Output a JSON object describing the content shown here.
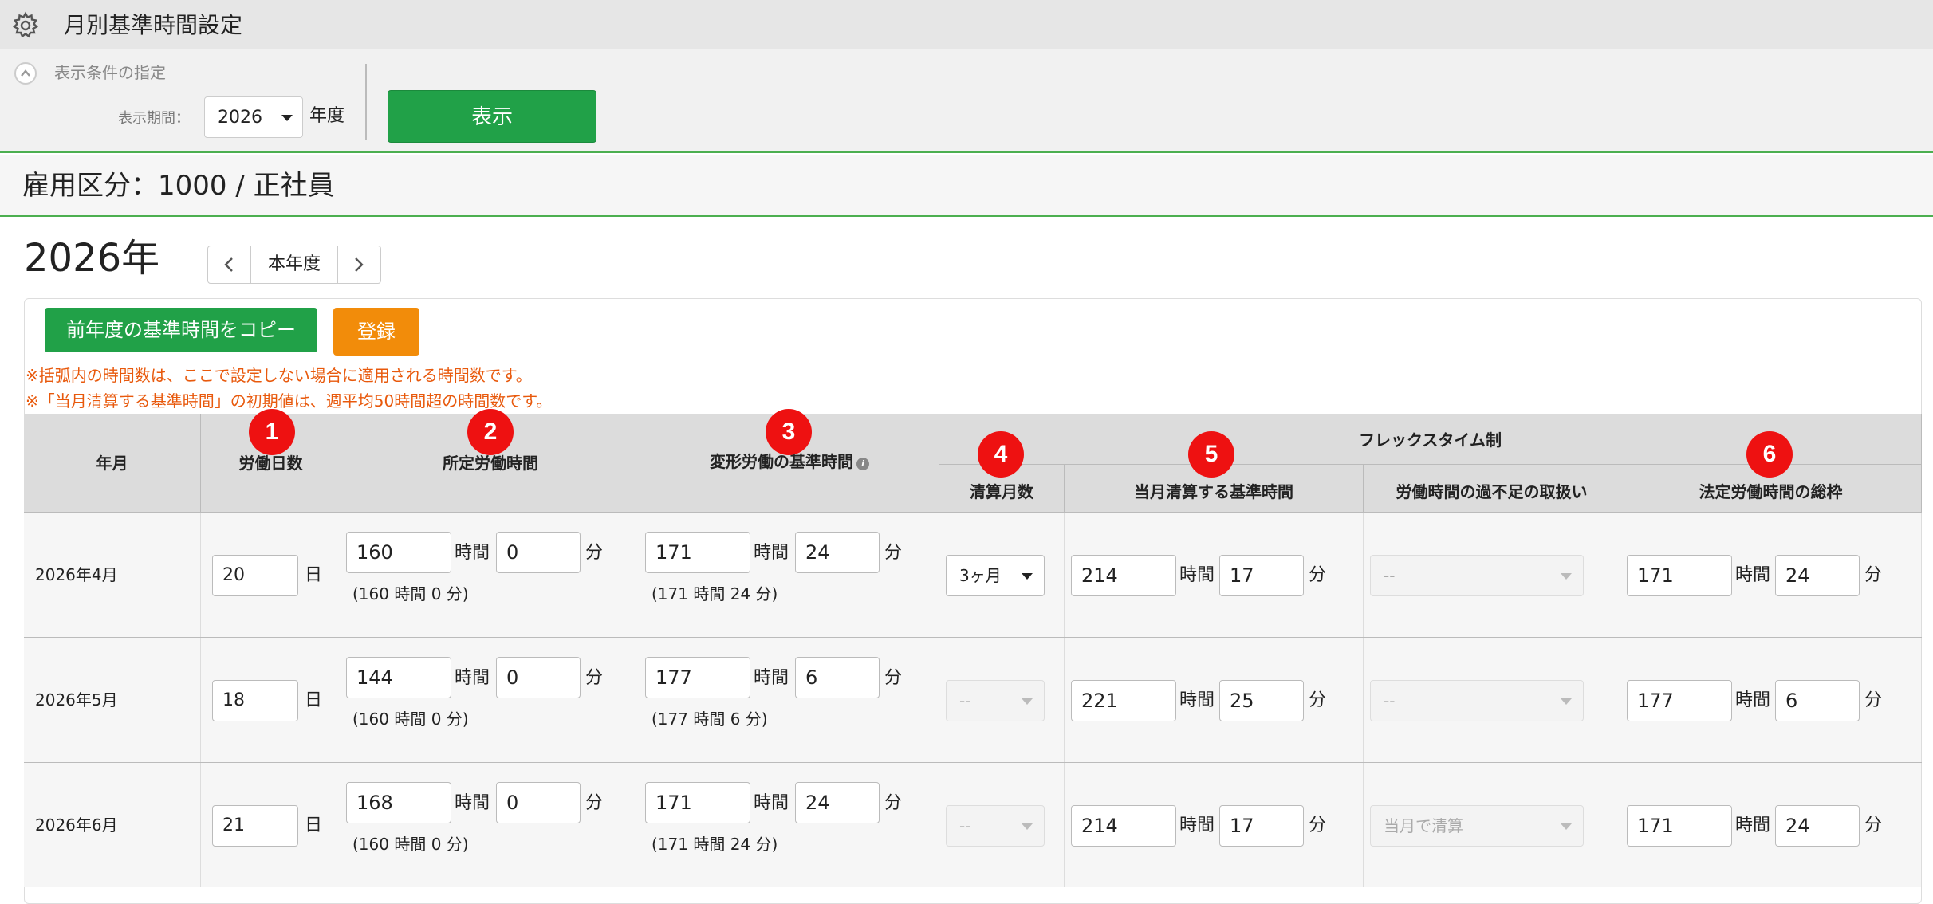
{
  "app": {
    "title": "月別基準時間設定",
    "icon": "gear-icon"
  },
  "conditions": {
    "toggle_label": "表示条件の指定",
    "period_label": "表示期間：",
    "year_value": "2026",
    "year_suffix": "年度",
    "show_button": "表示"
  },
  "employment": {
    "label": "雇用区分：1000 / 正社員"
  },
  "year_nav": {
    "title": "2026年",
    "current_label": "本年度"
  },
  "actions": {
    "copy_button": "前年度の基準時間をコピー",
    "register_button": "登録"
  },
  "notes": [
    "※括弧内の時間数は、ここで設定しない場合に適用される時間数です。",
    "※「当月清算する基準時間」の初期値は、週平均50時間超の時間数です。"
  ],
  "table": {
    "headers": {
      "year_month": "年月",
      "work_days": "労働日数",
      "prescribed_hours": "所定労働時間",
      "variable_hours": "変形労働の基準時間",
      "flex_group": "フレックスタイム制",
      "settlement_months": "清算月数",
      "monthly_settlement": "当月清算する基準時間",
      "excess_shortage": "労働時間の過不足の取扱い",
      "legal_total": "法定労働時間の総枠"
    },
    "badges": [
      "1",
      "2",
      "3",
      "4",
      "5",
      "6"
    ],
    "units": {
      "day": "日",
      "hour": "時間",
      "minute": "分"
    },
    "rows": [
      {
        "year_month": "2026年4月",
        "work_days": "20",
        "prescribed_h": "160",
        "prescribed_m": "0",
        "prescribed_default": "(160 時間 0 分)",
        "variable_h": "171",
        "variable_m": "24",
        "variable_default": "(171 時間 24 分)",
        "settlement_months": "3ヶ月",
        "monthly_h": "214",
        "monthly_m": "17",
        "excess_shortage": "--",
        "legal_h": "171",
        "legal_m": "24"
      },
      {
        "year_month": "2026年5月",
        "work_days": "18",
        "prescribed_h": "144",
        "prescribed_m": "0",
        "prescribed_default": "(160 時間 0 分)",
        "variable_h": "177",
        "variable_m": "6",
        "variable_default": "(177 時間 6 分)",
        "settlement_months": "--",
        "monthly_h": "221",
        "monthly_m": "25",
        "excess_shortage": "--",
        "legal_h": "177",
        "legal_m": "6"
      },
      {
        "year_month": "2026年6月",
        "work_days": "21",
        "prescribed_h": "168",
        "prescribed_m": "0",
        "prescribed_default": "(160 時間 0 分)",
        "variable_h": "171",
        "variable_m": "24",
        "variable_default": "(171 時間 24 分)",
        "settlement_months": "--",
        "monthly_h": "214",
        "monthly_m": "17",
        "excess_shortage": "当月で清算",
        "legal_h": "171",
        "legal_m": "24"
      }
    ]
  },
  "colors": {
    "accent_green": "#21a148",
    "register_orange": "#f28c0a",
    "note_orange": "#e8590c",
    "badge_red": "#ee1111"
  }
}
